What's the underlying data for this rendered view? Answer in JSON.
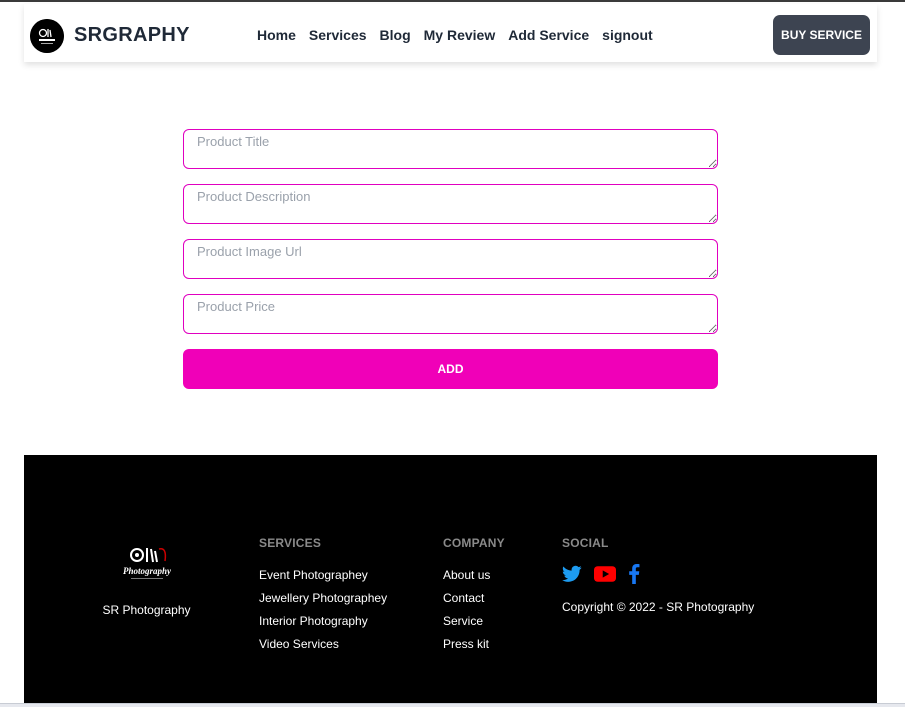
{
  "navbar": {
    "brand_name": "SRGRAPHY",
    "links": [
      "Home",
      "Services",
      "Blog",
      "My Review",
      "Add Service",
      "signout"
    ],
    "buy_button": "BUY SERVICE"
  },
  "form": {
    "title_placeholder": "Product Title",
    "description_placeholder": "Product Description",
    "image_placeholder": "Product Image Url",
    "price_placeholder": "Product Price",
    "add_button": "ADD"
  },
  "footer": {
    "brand_name": "SR Photography",
    "logo_text": "Photography",
    "services": {
      "heading": "SERVICES",
      "links": [
        "Event Photographey",
        "Jewellery Photographey",
        "Interior Photography",
        "Video Services"
      ]
    },
    "company": {
      "heading": "COMPANY",
      "links": [
        "About us",
        "Contact",
        "Service",
        "Press kit"
      ]
    },
    "social": {
      "heading": "SOCIAL",
      "icons": [
        "twitter-icon",
        "youtube-icon",
        "facebook-icon"
      ],
      "copyright": "Copyright © 2022 - SR Photography"
    }
  },
  "colors": {
    "accent": "#f000b8",
    "input_border": "#e000c0",
    "dark_button": "#3d4451",
    "footer_bg": "#000000",
    "twitter": "#1d9bf0",
    "youtube": "#ff0000",
    "facebook": "#1877f2"
  }
}
